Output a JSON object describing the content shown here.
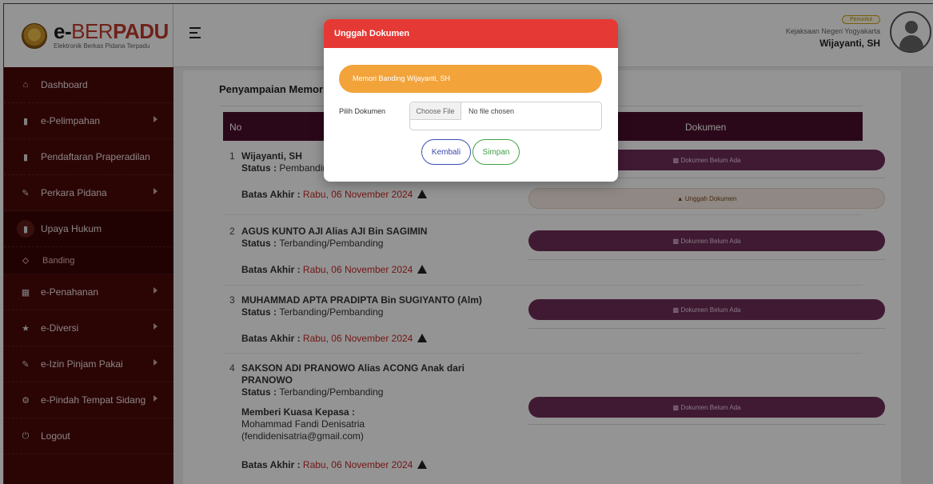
{
  "brand": {
    "pre": "e-",
    "mid": "BER",
    "post": "PADU",
    "subtitle": "Elektronik Berkas Pidana Terpadu"
  },
  "header": {
    "role_badge": "Penuntut",
    "office": "Kejaksaan Negeri Yogyakarta",
    "user_name": "Wijayanti, SH"
  },
  "sidebar": {
    "items": [
      {
        "label": "Dashboard",
        "icon": "home-icon"
      },
      {
        "label": "e-Pelimpahan",
        "icon": "document-icon"
      },
      {
        "label": "Pendaftaran Praperadilan",
        "icon": "document-icon"
      },
      {
        "label": "Perkara Pidana",
        "icon": "edit-icon"
      },
      {
        "label": "Upaya Hukum",
        "icon": "document-icon"
      },
      {
        "label": "Banding",
        "icon": "diamond-icon"
      },
      {
        "label": "e-Penahanan",
        "icon": "grid-icon"
      },
      {
        "label": "e-Diversi",
        "icon": "star-icon"
      },
      {
        "label": "e-Izin Pinjam Pakai",
        "icon": "edit-icon"
      },
      {
        "label": "e-Pindah Tempat Sidang",
        "icon": "cog-icon"
      },
      {
        "label": "Logout",
        "icon": "power-icon"
      }
    ]
  },
  "main": {
    "heading": "Penyampaian Memori",
    "table": {
      "col_no": "No",
      "col_dokumen": "Dokumen",
      "rows": [
        {
          "no": "1",
          "name": "Wijayanti, SH",
          "status_label": "Status :",
          "status": "Pembanding",
          "batas_label": "Batas Akhir :",
          "batas": "Rabu, 06 November 2024",
          "doc_button": "Dokumen Belum Ada",
          "upload_button": "Unggah Dokumen"
        },
        {
          "no": "2",
          "name": "AGUS KUNTO AJI Alias AJI Bin SAGIMIN",
          "status_label": "Status :",
          "status": "Terbanding/Pembanding",
          "batas_label": "Batas Akhir :",
          "batas": "Rabu, 06 November 2024",
          "doc_button": "Dokumen Belum Ada"
        },
        {
          "no": "3",
          "name": "MUHAMMAD APTA PRADIPTA Bin SUGIYANTO (Alm)",
          "status_label": "Status :",
          "status": "Terbanding/Pembanding",
          "batas_label": "Batas Akhir :",
          "batas": "Rabu, 06 November 2024",
          "doc_button": "Dokumen Belum Ada"
        },
        {
          "no": "4",
          "name": "SAKSON ADI PRANOWO Alias ACONG Anak dari PRANOWO",
          "status_label": "Status :",
          "status": "Terbanding/Pembanding",
          "kuasa_label": "Memberi Kuasa Kepasa :",
          "kuasa_name": "Mohammad Fandi Denisatria",
          "kuasa_email": "(fendidenisatria@gmail.com)",
          "batas_label": "Batas Akhir :",
          "batas": "Rabu, 06 November 2024",
          "doc_button": "Dokumen Belum Ada"
        }
      ]
    }
  },
  "modal": {
    "title": "Unggah Dokumen",
    "banner": "Memori Banding Wijayanti, SH",
    "file_label": "Pilih Dokumen",
    "file_button": "Choose File",
    "file_status": "No file chosen",
    "back_button": "Kembali",
    "save_button": "Simpan"
  },
  "colors": {
    "sidebar": "#4a0808",
    "table_header": "#4b0f2c",
    "doc_pill": "#6f2d58",
    "modal_header": "#e53935",
    "banner": "#f2a33a",
    "deadline": "#c62828"
  }
}
